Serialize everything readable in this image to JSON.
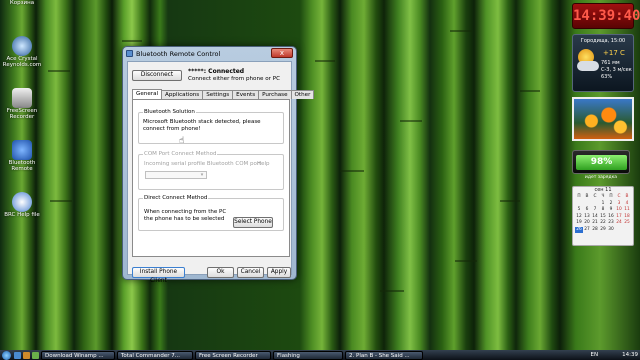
{
  "desktop": {
    "icons": [
      {
        "label": "Корзина"
      },
      {
        "label": "Ace Crystal Reynolds.com"
      },
      {
        "label": "FreeScreen Recorder"
      },
      {
        "label": "Bluetooth Remote"
      },
      {
        "label": "BRC Help file"
      }
    ]
  },
  "window": {
    "title": "Bluetooth Remote Control",
    "close": "x",
    "disconnect_label": "Disconnect",
    "status_line1": "*****: Connected",
    "status_line2": "Connect either from phone or PC",
    "tabs": [
      "General",
      "Applications",
      "Settings",
      "Events",
      "Purchase",
      "Other"
    ],
    "active_tab": "General",
    "bluetooth_solution": {
      "legend": "Bluetooth Solution",
      "text": "Microsoft Bluetooth stack detected, please connect from phone!"
    },
    "com_port": {
      "legend": "COM Port Connect Method",
      "text": "Incoming serial profile Bluetooth COM port",
      "help": "Help"
    },
    "direct_connect": {
      "legend": "Direct Connect Method",
      "text": "When connecting from the PC the phone has to be selected",
      "select_phone_label": "Select Phone"
    },
    "buttons": {
      "install_label": "Install Phone Client",
      "ok_label": "Ok",
      "cancel_label": "Cancel",
      "apply_label": "Apply"
    }
  },
  "gadgets": {
    "clock_time": "14:39:40",
    "weather": {
      "city": "Городища, 15:00",
      "temp": "+17 C",
      "line1": "761 мм",
      "line2": "С-З, 3 м/сек",
      "line3": "63%"
    },
    "battery": {
      "percent": "98%",
      "level": 0.98,
      "label": "идет зарядка"
    },
    "calendar": {
      "month": "сен 11",
      "days_header": [
        "П",
        "В",
        "С",
        "Ч",
        "П",
        "С",
        "В"
      ],
      "cells": [
        "",
        "",
        "",
        "1",
        "2",
        "3",
        "4",
        "5",
        "6",
        "7",
        "8",
        "9",
        "10",
        "11",
        "12",
        "13",
        "14",
        "15",
        "16",
        "17",
        "18",
        "19",
        "20",
        "21",
        "22",
        "23",
        "24",
        "25",
        "26",
        "27",
        "28",
        "29",
        "30",
        "",
        ""
      ],
      "today": "26"
    }
  },
  "taskbar": {
    "items": [
      "Download Winamp ...",
      "Total Commander 7...",
      "Free Screen Recorder",
      "Flashing",
      "2. Plan B - She Said ..."
    ],
    "language": "EN",
    "time": "14:39"
  },
  "colors": {
    "accent": "#2c6fd0",
    "clock_red": "#ff5a4a",
    "battery_green": "#2fa020"
  }
}
